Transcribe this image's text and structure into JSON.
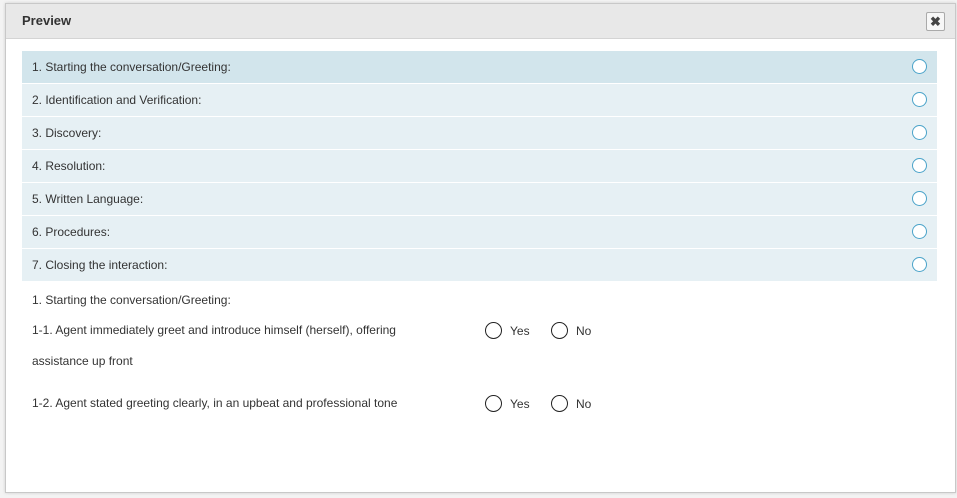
{
  "dialog": {
    "title": "Preview",
    "close_label": "✖"
  },
  "sections": [
    {
      "label": "1. Starting the conversation/Greeting:"
    },
    {
      "label": "2. Identification and Verification:"
    },
    {
      "label": "3. Discovery:"
    },
    {
      "label": "4. Resolution:"
    },
    {
      "label": "5. Written Language:"
    },
    {
      "label": "6. Procedures:"
    },
    {
      "label": "7. Closing the interaction:"
    }
  ],
  "detail": {
    "section_title": "1. Starting the conversation/Greeting:",
    "questions": [
      {
        "text": "1-1. Agent immediately greet and introduce himself (herself), offering assistance up front",
        "yes": "Yes",
        "no": "No"
      },
      {
        "text": "1-2. Agent stated greeting clearly, in an upbeat and professional tone",
        "yes": "Yes",
        "no": "No"
      }
    ]
  },
  "colors": {
    "row_bg": "#e6f0f4",
    "row_active_bg": "#d2e5ec",
    "radio_accent": "#4aa3c9"
  }
}
